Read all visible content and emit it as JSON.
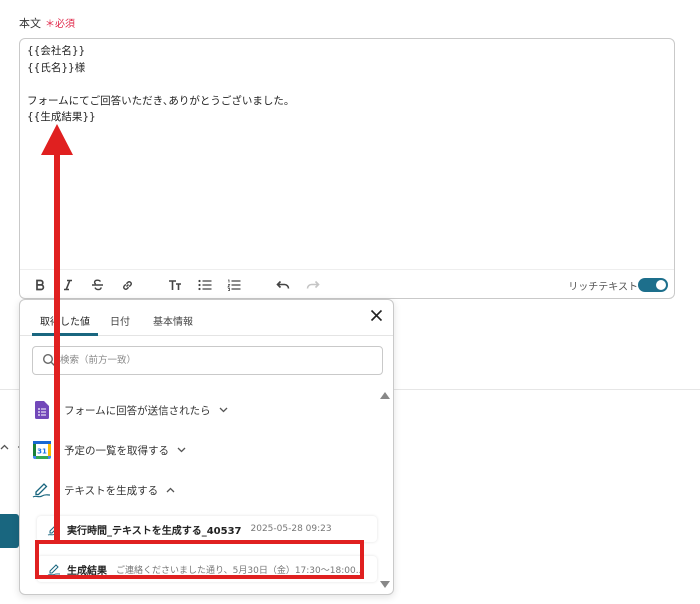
{
  "field": {
    "label": "本文",
    "required_mark": "＊必須"
  },
  "editor": {
    "lines": [
      "{{会社名}}",
      "{{氏名}}様",
      "",
      "フォームにてご回答いただき､ありがとうございました。",
      "{{生成結果}}"
    ],
    "toolbar": {
      "buttons": [
        "bold-icon",
        "italic-icon",
        "strikethrough-icon",
        "link-icon",
        "font-size-icon",
        "bullet-list-icon",
        "numbered-list-icon",
        "undo-icon",
        "redo-icon"
      ],
      "rich_text_label": "リッチテキスト",
      "rich_text_enabled": true
    }
  },
  "popup": {
    "tabs": [
      {
        "label": "取得した値",
        "active": true
      },
      {
        "label": "日付",
        "active": false
      },
      {
        "label": "基本情報",
        "active": false
      }
    ],
    "search": {
      "placeholder": "検索（前方一致）"
    },
    "groups": [
      {
        "label": "フォームに回答が送信されたら",
        "icon": "google-forms-icon",
        "expanded": false
      },
      {
        "label": "予定の一覧を取得する",
        "icon": "google-calendar-icon",
        "expanded": false
      },
      {
        "label": "テキストを生成する",
        "icon": "ai-pen-icon",
        "expanded": true
      }
    ],
    "items": [
      {
        "label": "実行時間_テキストを生成する_40537",
        "value": "2025-05-28 09:23"
      },
      {
        "label": "生成結果",
        "value": "ご連絡くださいました通り、5月30日（金）17:30〜18:00..."
      }
    ]
  },
  "colors": {
    "accent": "#19667f",
    "required": "#e0284a",
    "annotation": "#e02020"
  }
}
